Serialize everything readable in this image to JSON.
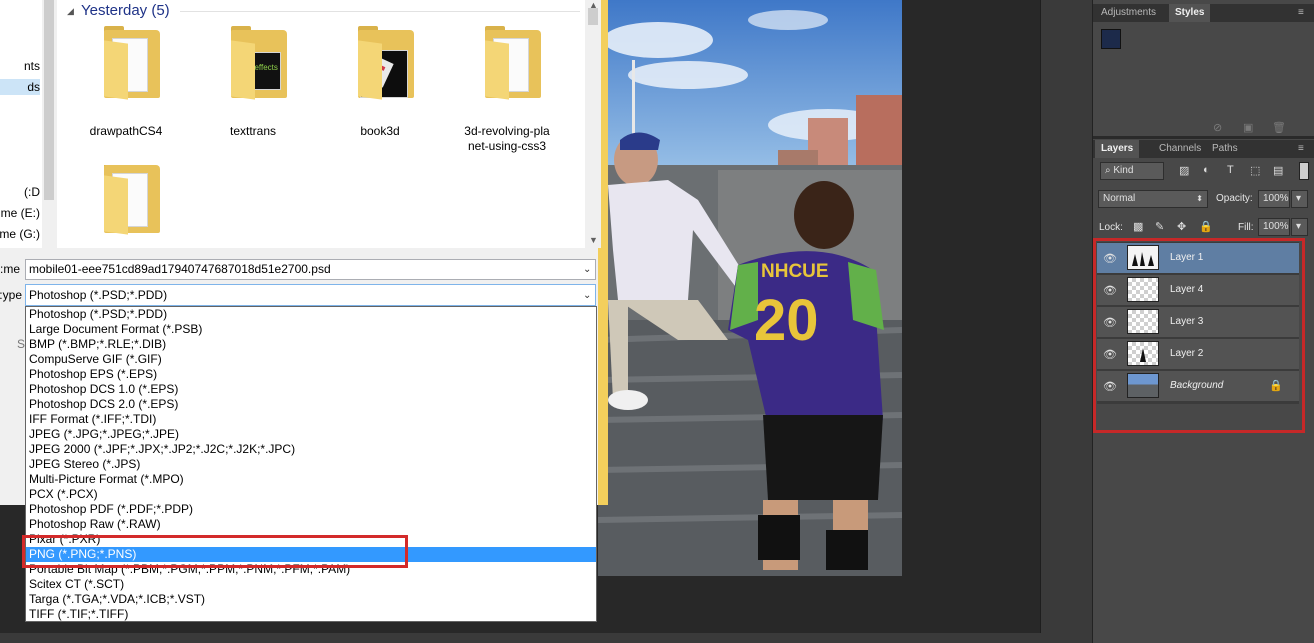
{
  "save_dialog": {
    "nav_items": [
      "nts",
      "ds",
      "D:)",
      "ume (E:)",
      "ume (G:)"
    ],
    "group_header": "Yesterday (5)",
    "files": [
      {
        "name": "drawpathCS4",
        "thumb": "folder-icon"
      },
      {
        "name": "texttrans",
        "thumb": "folder-icon",
        "preview_text": "al effects"
      },
      {
        "name": "book3d",
        "thumb": "folder-icon"
      },
      {
        "name": "3d-revolving-planet-using-css3",
        "line1": "3d-revolving-pla",
        "line2": "net-using-css3",
        "thumb": "folder-icon"
      },
      {
        "name": "",
        "thumb": "folder-icon"
      }
    ],
    "filename_label": "me:",
    "filename_value": "mobile01-eee751cd89ad17940747687018d51e2700.psd",
    "type_label": "ype:",
    "type_value": "Photoshop (*.PSD;*.PDD)",
    "type_options": [
      "Photoshop (*.PSD;*.PDD)",
      "Large Document Format (*.PSB)",
      "BMP (*.BMP;*.RLE;*.DIB)",
      "CompuServe GIF (*.GIF)",
      "Photoshop EPS (*.EPS)",
      "Photoshop DCS 1.0 (*.EPS)",
      "Photoshop DCS 2.0 (*.EPS)",
      "IFF Format (*.IFF;*.TDI)",
      "JPEG (*.JPG;*.JPEG;*.JPE)",
      "JPEG 2000 (*.JPF;*.JPX;*.JP2;*.J2C;*.J2K;*.JPC)",
      "JPEG Stereo (*.JPS)",
      "Multi-Picture Format (*.MPO)",
      "PCX (*.PCX)",
      "Photoshop PDF (*.PDF;*.PDP)",
      "Photoshop Raw (*.RAW)",
      "Pixar (*.PXR)",
      "PNG (*.PNG;*.PNS)",
      "Portable Bit Map (*.PBM;*.PGM;*.PPM;*.PNM;*.PFM;*.PAM)",
      "Scitex CT (*.SCT)",
      "Targa (*.TGA;*.VDA;*.ICB;*.VST)",
      "TIFF (*.TIF;*.TIFF)"
    ],
    "selected_option": "PNG (*.PNG;*.PNS)",
    "partial_label": "S"
  },
  "photo": {
    "jersey_text": "NHCUE",
    "jersey_number": "20"
  },
  "panels": {
    "adjustments_tabs": [
      "Adjustments",
      "Styles"
    ],
    "adjustments_active": "Styles",
    "layers_tabs": [
      "Layers",
      "Channels",
      "Paths"
    ],
    "layers_active": "Layers",
    "kind_label": "Kind",
    "blend_mode": "Normal",
    "opacity_label": "Opacity:",
    "opacity_value": "100%",
    "lock_label": "Lock:",
    "fill_label": "Fill:",
    "fill_value": "100%",
    "layers": [
      {
        "name": "Layer 1",
        "selected": true
      },
      {
        "name": "Layer 4",
        "selected": false
      },
      {
        "name": "Layer 3",
        "selected": false
      },
      {
        "name": "Layer 2",
        "selected": false
      },
      {
        "name": "Background",
        "selected": false,
        "locked": true
      }
    ]
  },
  "colors": {
    "highlight_red": "#d32a2a",
    "selection_blue": "#3399ff",
    "ps_panel": "#484848",
    "ps_selected_layer": "#5f7ea3"
  }
}
